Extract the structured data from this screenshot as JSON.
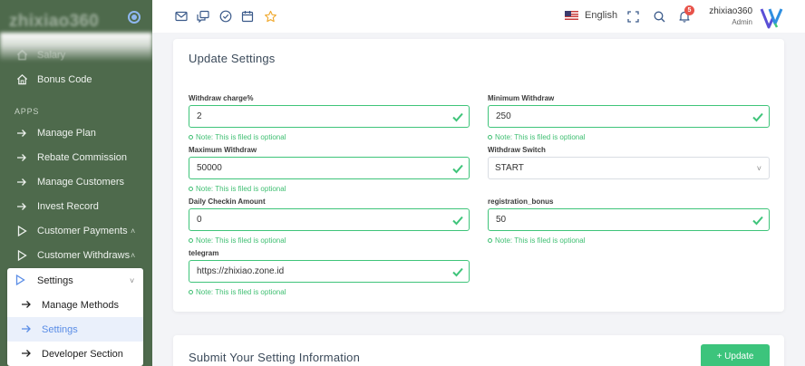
{
  "brand": {
    "name": "zhixiao360"
  },
  "sidebar": {
    "items_top": [
      {
        "label": "Salary",
        "icon": "home-icon"
      },
      {
        "label": "Bonus Code",
        "icon": "home-icon"
      }
    ],
    "section_label": "APPS",
    "items": [
      {
        "label": "Manage Plan",
        "icon": "arrow-right-icon"
      },
      {
        "label": "Rebate Commission",
        "icon": "arrow-right-icon"
      },
      {
        "label": "Manage Customers",
        "icon": "arrow-right-icon"
      },
      {
        "label": "Invest Record",
        "icon": "arrow-right-icon"
      },
      {
        "label": "Customer Payments",
        "icon": "play-icon"
      },
      {
        "label": "Customer Withdraws",
        "icon": "play-icon"
      }
    ],
    "submenu": {
      "label": "Settings",
      "items": [
        {
          "label": "Manage Methods"
        },
        {
          "label": "Settings",
          "active": true
        },
        {
          "label": "Developer Section"
        }
      ]
    }
  },
  "topbar": {
    "language": "English",
    "notification_count": "5",
    "user_name": "zhixiao360",
    "user_role": "Admin"
  },
  "settings_form": {
    "title": "Update Settings",
    "note": "Note: This is filed is optional",
    "fields": {
      "withdraw_charge": {
        "label": "Withdraw charge%",
        "value": "2"
      },
      "minimum_withdraw": {
        "label": "Minimum Withdraw",
        "value": "250"
      },
      "maximum_withdraw": {
        "label": "Maximum Withdraw",
        "value": "50000"
      },
      "withdraw_switch": {
        "label": "Withdraw Switch",
        "value": "START"
      },
      "daily_checkin": {
        "label": "Daily Checkin Amount",
        "value": "0"
      },
      "registration_bonus": {
        "label": "registration_bonus",
        "value": "50"
      },
      "telegram": {
        "label": "telegram",
        "value": "https://zhixiao.zone.id"
      }
    }
  },
  "submit_section": {
    "title": "Submit Your Setting Information",
    "update_label": "+ Update"
  },
  "colors": {
    "sidebar_bg": "#4e6a4c",
    "valid_green": "#3fc47a",
    "active_blue": "#5a8de6",
    "badge_red": "#e8534a"
  }
}
